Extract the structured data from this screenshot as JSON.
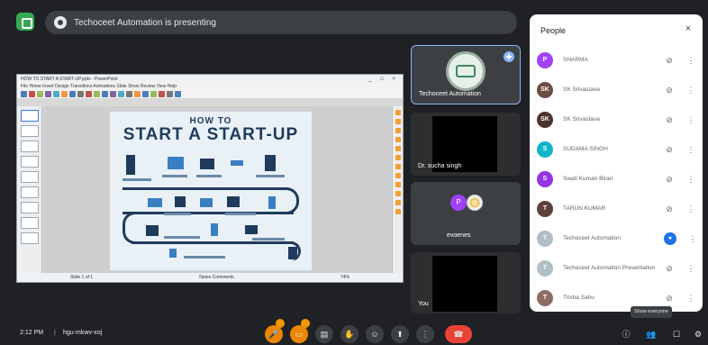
{
  "meeting": {
    "title": "Techoceet Automation is presenting",
    "time": "2:12 PM",
    "separator": "|",
    "code": "hgu-mkwv-xoj"
  },
  "presentation": {
    "window_title": "HOW TO START A START-UP.pptx - PowerPoint",
    "window_controls": "_ □ ×",
    "menu": "File  Home  Insert  Design  Transitions  Animations  Slide Show  Review  View  Help",
    "slide_title_line1": "HOW TO",
    "slide_title_line2": "START A START-UP",
    "status_left": "Slide 1 of 1",
    "status_mid": "Notes   Comments",
    "status_right": "74%"
  },
  "tiles": [
    {
      "name": "Techoceet Automation"
    },
    {
      "name": "Dr. sucha singh"
    },
    {
      "name": "P",
      "label": "evoenes"
    },
    {
      "name": "You"
    }
  ],
  "people": {
    "title": "People",
    "close": "×",
    "rows": [
      {
        "initial": "P",
        "name": "SHARMA",
        "color": "#a142f4",
        "mic": "muted"
      },
      {
        "initial": "SK",
        "name": "SK Srivastava",
        "color": "#6d4c41",
        "mic": "muted"
      },
      {
        "initial": "SK",
        "name": "SK Srivastava",
        "color": "#4e342e",
        "mic": "muted"
      },
      {
        "initial": "S",
        "name": "SUDAMA SINGH",
        "color": "#12b5cb",
        "mic": "muted"
      },
      {
        "initial": "S",
        "name": "Swati Kumari Birari",
        "color": "#9334e6",
        "mic": "muted"
      },
      {
        "initial": "T",
        "name": "TARUN KUMAR",
        "color": "#5d4037",
        "mic": "muted"
      },
      {
        "initial": "T",
        "name": "Techoceet Automation",
        "color": "#b0bec5",
        "mic": "live"
      },
      {
        "initial": "T",
        "name": "Techoceet Automation Presentation",
        "color": "#b0bec5",
        "mic": "muted"
      },
      {
        "initial": "T",
        "name": "Trisha Sahu",
        "color": "#8d6e63",
        "mic": "muted"
      }
    ]
  },
  "toolbar": {
    "mic": "🎤",
    "camera": "▭",
    "captions": "▤",
    "raise_hand": "✋",
    "emoji": "☺",
    "present": "⬆",
    "more": "⋮",
    "end_call": "☎",
    "info": "ⓘ",
    "people": "👥",
    "chat": "☐",
    "activities": "⚙",
    "tooltip": "Show everyone"
  },
  "colors": {
    "background": "#202124",
    "panel": "#ffffff",
    "accent": "#8ab4f8",
    "end_call": "#ea4335",
    "slide_navy": "#1f3b5c"
  }
}
